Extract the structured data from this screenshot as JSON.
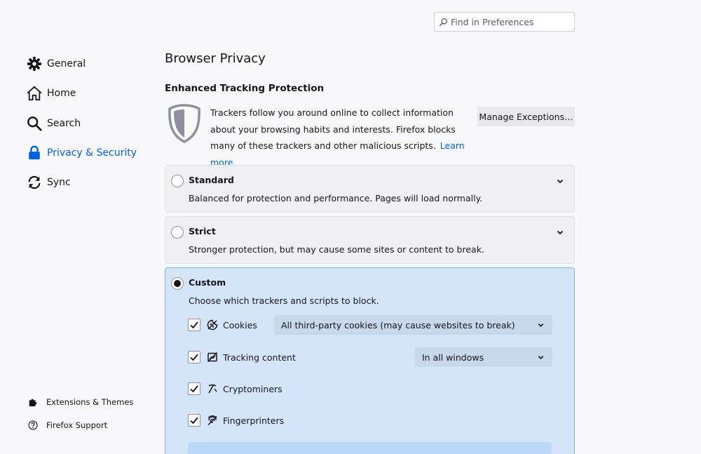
{
  "search": {
    "placeholder": "Find in Preferences"
  },
  "nav": {
    "items": [
      {
        "label": "General",
        "icon": "gear-icon"
      },
      {
        "label": "Home",
        "icon": "home-icon"
      },
      {
        "label": "Search",
        "icon": "magnifier-icon"
      },
      {
        "label": "Privacy & Security",
        "icon": "lock-icon",
        "active": true
      },
      {
        "label": "Sync",
        "icon": "sync-icon"
      }
    ],
    "footer": [
      {
        "label": "Extensions & Themes",
        "icon": "puzzle-icon"
      },
      {
        "label": "Firefox Support",
        "icon": "help-icon"
      }
    ]
  },
  "main": {
    "title": "Browser Privacy",
    "etp": {
      "heading": "Enhanced Tracking Protection",
      "intro": "Trackers follow you around online to collect information about your browsing habits and interests. Firefox blocks many of these trackers and other malicious scripts.",
      "learn_more": "Learn more",
      "manage_button": "Manage Exceptions…"
    },
    "options": [
      {
        "title": "Standard",
        "description": "Balanced for protection and performance. Pages will load normally.",
        "selected": false
      },
      {
        "title": "Strict",
        "description": "Stronger protection, but may cause some sites or content to break.",
        "selected": false
      },
      {
        "title": "Custom",
        "description": "Choose which trackers and scripts to block.",
        "selected": true
      }
    ],
    "custom": {
      "cookies": {
        "label": "Cookies",
        "checked": true,
        "select_value": "All third-party cookies (may cause websites to break)"
      },
      "tracking": {
        "label": "Tracking content",
        "checked": true,
        "select_value": "In all windows"
      },
      "cryptominers": {
        "label": "Cryptominers",
        "checked": true
      },
      "fingerprinters": {
        "label": "Fingerprinters",
        "checked": true
      }
    }
  },
  "colors": {
    "accent": "#0061e0",
    "custom_bg": "#d5e5f9",
    "custom_border": "#80b5f3"
  }
}
